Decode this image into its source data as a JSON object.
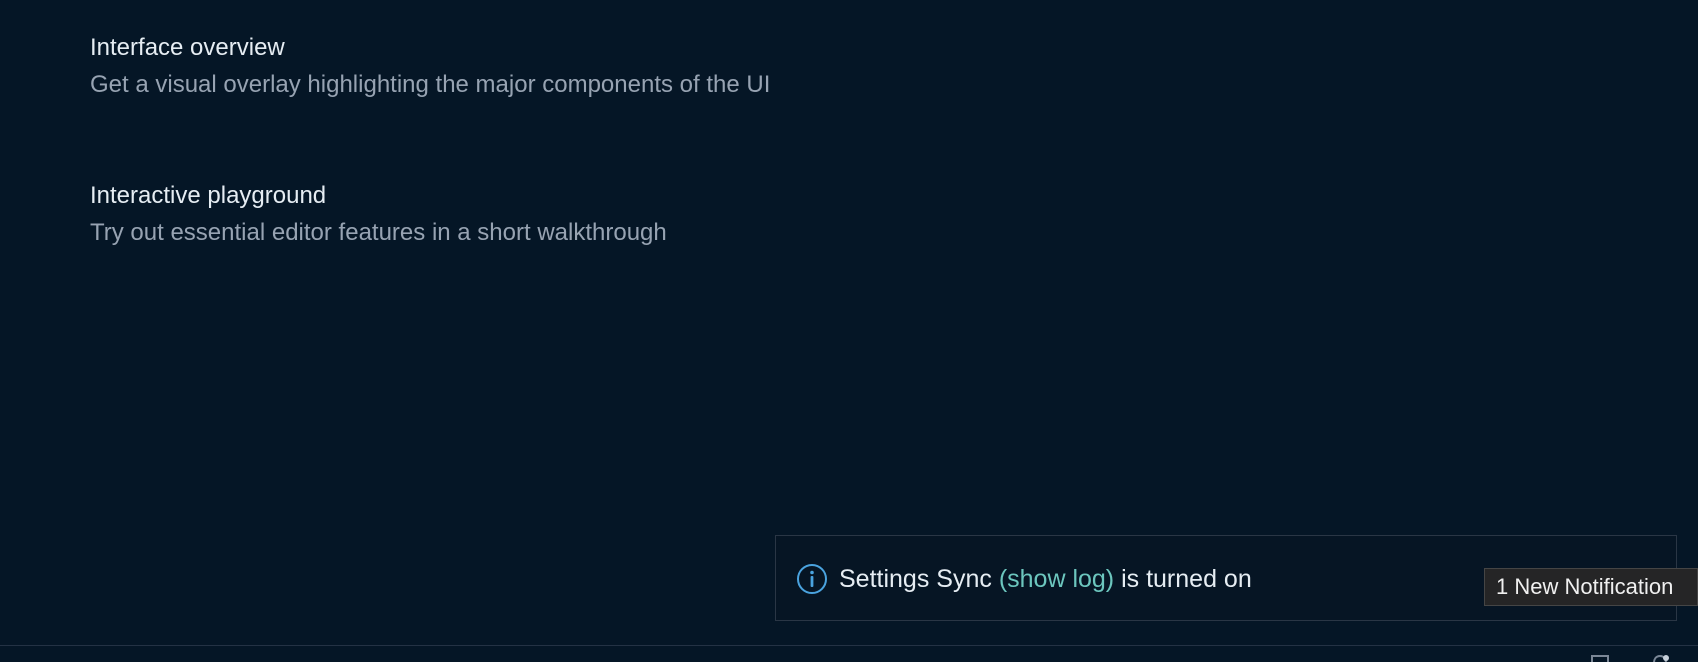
{
  "walkthrough": {
    "items": [
      {
        "title": "Interface overview",
        "description": "Get a visual overlay highlighting the major components of the UI"
      },
      {
        "title": "Interactive playground",
        "description": "Try out essential editor features in a short walkthrough"
      }
    ]
  },
  "notification": {
    "icon": "info-icon",
    "text_before": "Settings Sync ",
    "link_label": "(show log)",
    "text_after": " is turned on"
  },
  "tooltip": {
    "text": "1 New Notification"
  },
  "statusbar": {
    "icons": [
      "layout-icon",
      "notification-bell-icon"
    ]
  },
  "colors": {
    "background": "#051626",
    "title_text": "#e6edf3",
    "description_text": "#97a3b2",
    "link": "#6cc6be",
    "info_icon": "#4aa3df"
  }
}
